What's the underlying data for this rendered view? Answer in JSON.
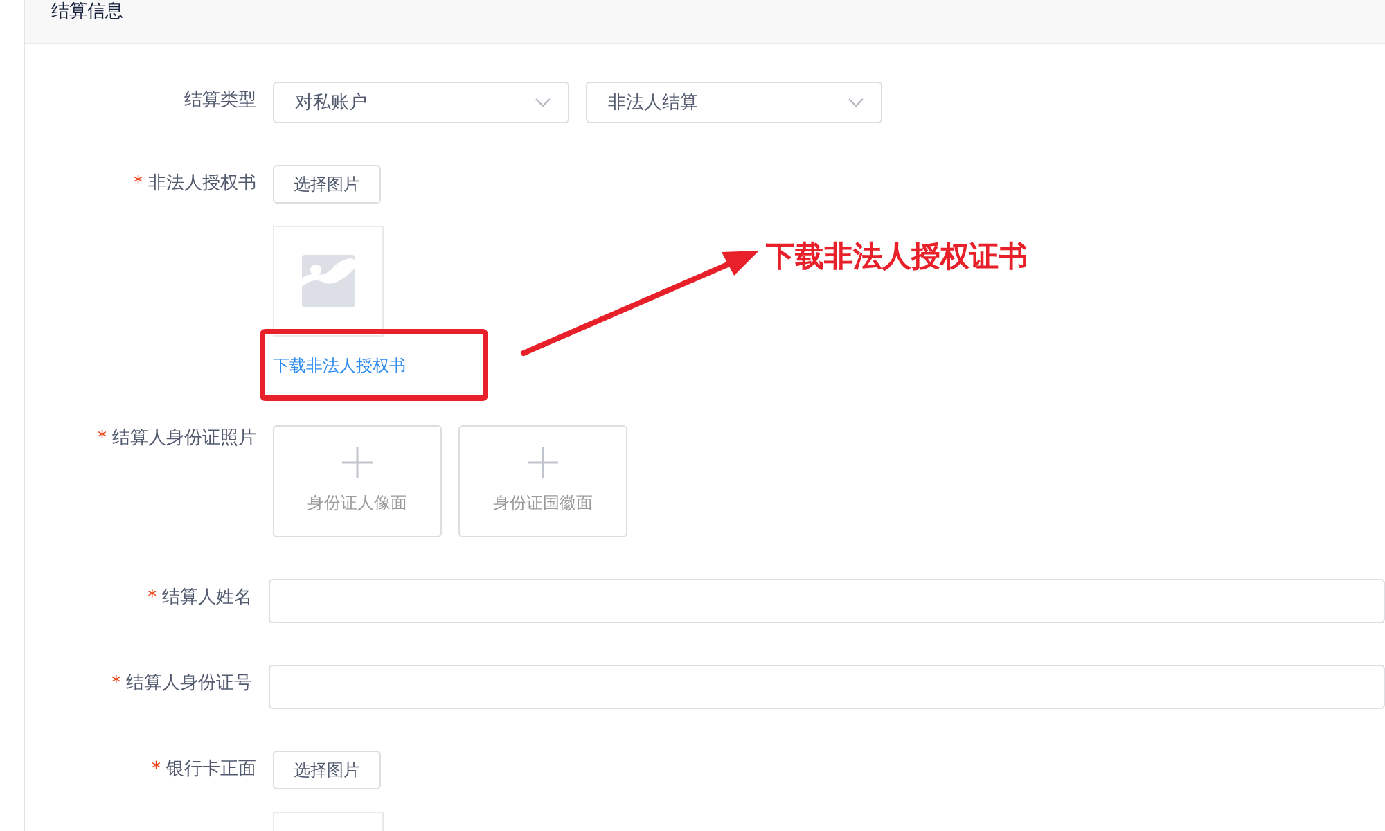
{
  "panel": {
    "title": "结算信息"
  },
  "fields": [
    {
      "kind": "select-pair",
      "label": "结算类型",
      "selects": [
        {
          "value": "对私账户"
        },
        {
          "value": "非法人结算"
        }
      ]
    },
    {
      "kind": "image-upload",
      "label": "非法人授权书",
      "required_mark": "*",
      "button": "选择图片",
      "link": "下载非法人授权书"
    },
    {
      "kind": "card-upload",
      "label": "结算人身份证照片",
      "required_mark": "*",
      "cards": [
        "身份证人像面",
        "身份证国徽面"
      ]
    },
    {
      "kind": "text-input",
      "label": "结算人姓名",
      "required_mark": "*"
    },
    {
      "kind": "text-input",
      "label": "结算人身份证号",
      "required_mark": "*"
    },
    {
      "kind": "image-upload",
      "label": "银行卡正面",
      "required_mark": "*",
      "button": "选择图片"
    }
  ],
  "annotation": {
    "text": "下载非法人授权证书"
  }
}
